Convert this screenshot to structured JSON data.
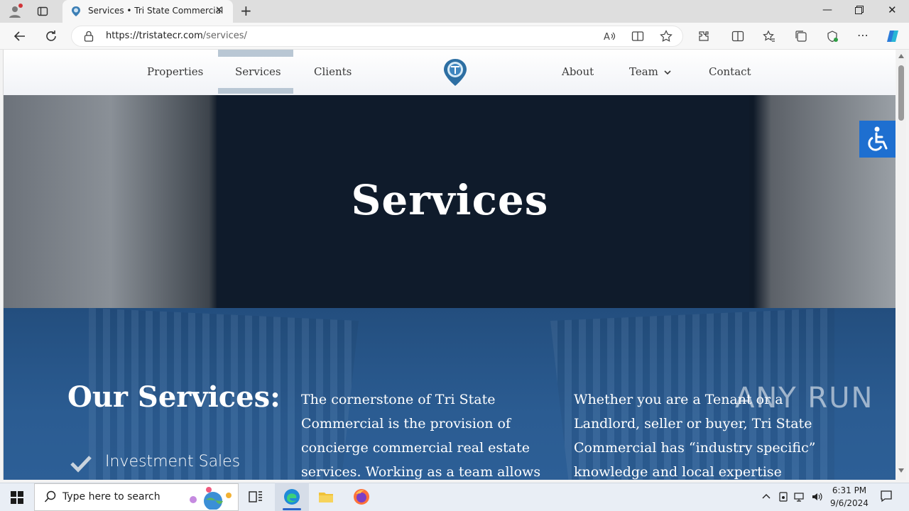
{
  "browser": {
    "tab_title": "Services • Tri State Commercial",
    "url_host": "https://tristatecr.com",
    "url_path": "/services/"
  },
  "site": {
    "nav": {
      "properties": "Properties",
      "services": "Services",
      "clients": "Clients",
      "about": "About",
      "team": "Team",
      "contact": "Contact"
    },
    "hero_title": "Services",
    "services_heading": "Our Services:",
    "service_items": [
      "Investment Sales"
    ],
    "paragraph_1": "The cornerstone of Tri State Commercial is the provision of concierge commercial real estate services. Working as a team allows",
    "paragraph_2": "Whether you are a Tenant or a Landlord, seller or buyer, Tri State Commercial has “industry specific” knowledge and local expertise"
  },
  "watermark": "ANY RUN",
  "taskbar": {
    "search_placeholder": "Type here to search",
    "time": "6:31 PM",
    "date": "9/6/2024"
  },
  "colors": {
    "accent": "#1e6fd0",
    "nav_active": "#b9c7d4",
    "services_bg": "#2b5c92"
  }
}
